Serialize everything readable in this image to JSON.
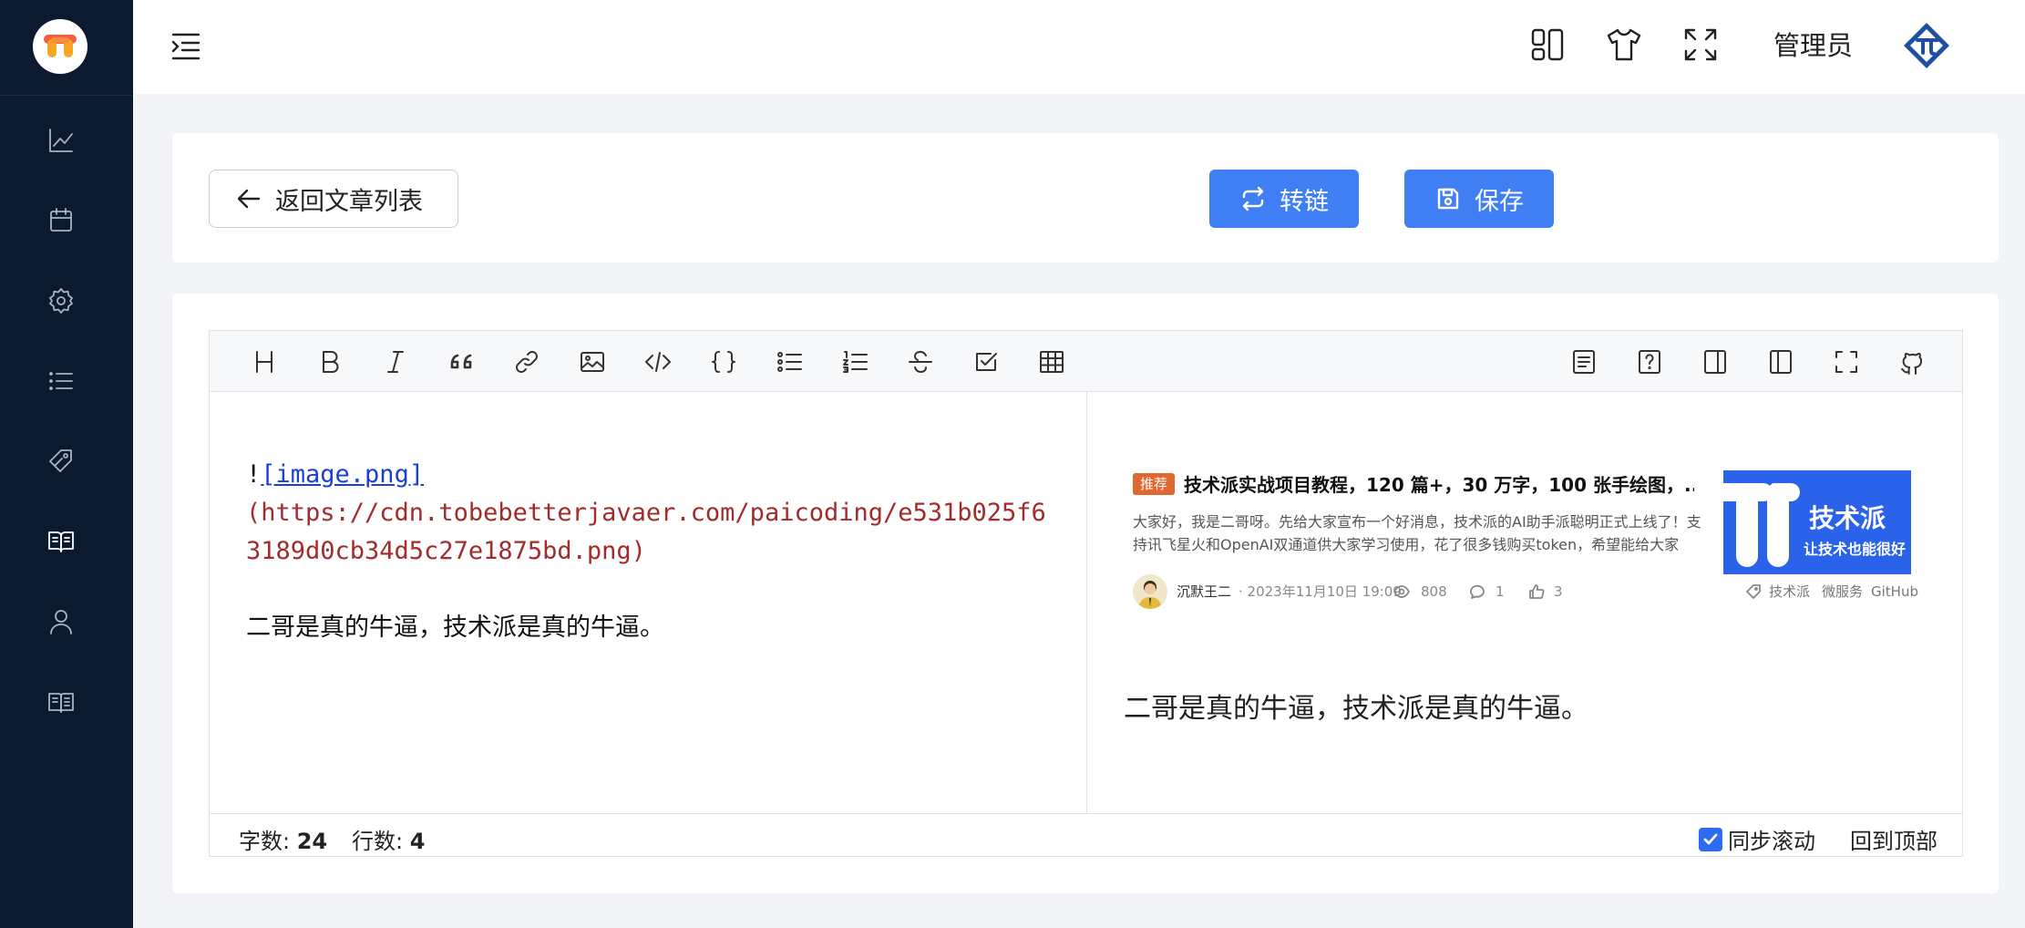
{
  "header": {
    "admin_name": "管理员"
  },
  "actions": {
    "back_label": "返回文章列表",
    "transfer_label": "转链",
    "save_label": "保存"
  },
  "editor": {
    "source": {
      "image_bang": "!",
      "image_link": "[image.png]",
      "image_url": "(https://cdn.tobebetterjavaer.com/paicoding/e531b025f63189d0cb34d5c27e1875bd.png)",
      "text": "二哥是真的牛逼，技术派是真的牛逼。"
    },
    "preview": {
      "tag": "推荐",
      "title": "技术派实战项目教程，120 篇+，30 万字，100 张手绘图，...",
      "summary": "大家好，我是二哥呀。先给大家宣布一个好消息，技术派的AI助手派聪明正式上线了！支持讯飞星火和OpenAI双通道供大家学习使用，花了很多钱购买token，希望能给大家的...",
      "author": "沉默王二",
      "date": "· 2023年11月10日 19:09",
      "views": "808",
      "comments": "1",
      "likes": "3",
      "tags": [
        "技术派",
        "微服务",
        "GitHub"
      ],
      "cover_title": "技术派",
      "cover_sub": "让技术也能很好",
      "body": "二哥是真的牛逼，技术派是真的牛逼。"
    },
    "status": {
      "words_label": "字数: ",
      "words": "24",
      "lines_label": "行数: ",
      "lines": "4",
      "sync_scroll_label": "同步滚动",
      "sync_scroll_checked": true,
      "back_to_top_label": "回到顶部"
    }
  },
  "colors": {
    "sidebar_bg": "#0c1a30",
    "primary": "#3f7ef3",
    "page_bg": "#f3f4f8",
    "tag_bg": "#e0672f",
    "link": "#1a3fd6",
    "url": "#a22b2b"
  },
  "icons": {
    "sidebar": [
      "chart-line-icon",
      "calendar-icon",
      "settings-icon",
      "list-icon",
      "tag-icon",
      "book-open-icon",
      "user-icon",
      "book-icon"
    ],
    "toolbar_left": [
      "heading-icon",
      "bold-icon",
      "italic-icon",
      "quote-icon",
      "link-icon",
      "image-icon",
      "code-icon",
      "code-block-icon",
      "unordered-list-icon",
      "ordered-list-icon",
      "strikethrough-icon",
      "task-list-icon",
      "table-icon"
    ],
    "toolbar_right": [
      "toc-icon",
      "help-icon",
      "preview-only-icon",
      "editor-only-icon",
      "fullscreen-icon",
      "github-icon"
    ]
  }
}
